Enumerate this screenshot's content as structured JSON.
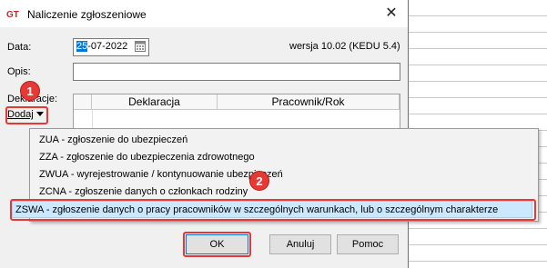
{
  "window": {
    "title": "Naliczenie zgłoszeniowe",
    "app_icon": "app-logo-icon",
    "close_icon": "close-icon"
  },
  "form": {
    "date_label": "Data:",
    "date_value_selected": "25",
    "date_value_rest": "-07-2022",
    "version": "wersja 10.02 (KEDU 5.4)",
    "opis_label": "Opis:",
    "opis_value": "",
    "deklaracje_label": "Deklaracje:",
    "dodaj_label": "Dodaj"
  },
  "grid": {
    "columns": [
      "Deklaracja",
      "Pracownik/Rok"
    ]
  },
  "menu": {
    "items": [
      "ZUA - zgłoszenie do ubezpieczeń",
      "ZZA - zgłoszenie do ubezpieczenia zdrowotnego",
      "ZWUA - wyrejestrowanie / kontynuowanie ubezpieczeń",
      "ZCNA - zgłoszenie danych o członkach rodziny",
      "ZSWA - zgłoszenie danych o pracy pracowników w szczególnych warunkach, lub o szczególnym charakterze"
    ],
    "highlighted_index": 4
  },
  "buttons": {
    "ok": "OK",
    "cancel": "Anuluj",
    "help": "Pomoc"
  },
  "annotations": {
    "badge_1": "1",
    "badge_2": "2",
    "color": "#e53935"
  }
}
